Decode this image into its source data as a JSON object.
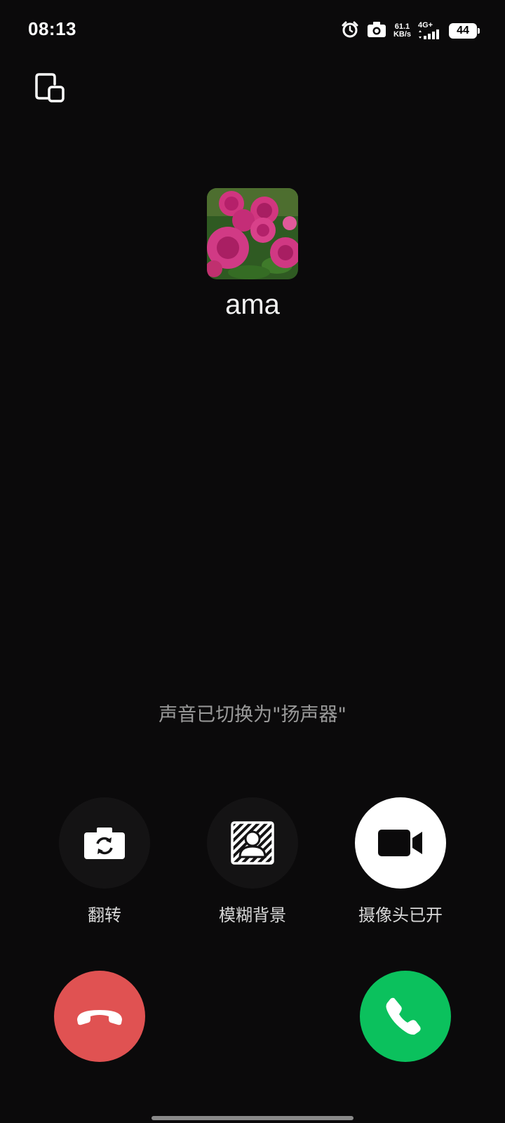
{
  "status_bar": {
    "time": "08:13",
    "net_speed_value": "61.1",
    "net_speed_unit": "KB/s",
    "network_type": "4G+",
    "battery": "44",
    "icons": [
      "alarm-icon",
      "camera-icon",
      "signal-icon",
      "battery-icon"
    ]
  },
  "call": {
    "caller_name": "ama",
    "avatar": "peony-flowers-photo",
    "status_message": "声音已切换为\"扬声器\""
  },
  "controls": [
    {
      "label": "翻转",
      "icon": "camera-flip-icon",
      "active": false
    },
    {
      "label": "模糊背景",
      "icon": "blur-background-icon",
      "active": false
    },
    {
      "label": "摄像头已开",
      "icon": "video-camera-icon",
      "active": true
    }
  ],
  "colors": {
    "background": "#0b0a0b",
    "decline": "#e05252",
    "accept": "#0bc15d",
    "message": "#9a9a9a"
  }
}
